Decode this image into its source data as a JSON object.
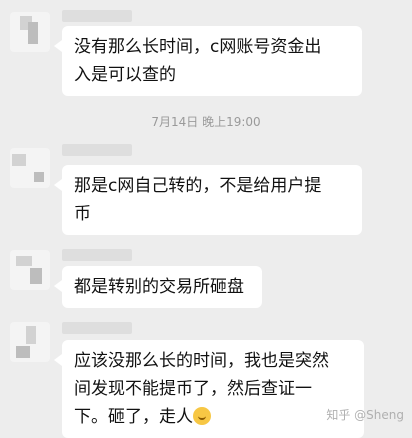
{
  "messages": [
    {
      "lines": [
        "没有那么长时间，c网账号资金出",
        "入是可以查的"
      ]
    },
    {
      "lines": [
        "那是c网自己转的，不是给用户提",
        "币"
      ]
    },
    {
      "lines": [
        "都是转别的交易所砸盘"
      ]
    },
    {
      "lines": [
        "应该没那么长的时间，我也是突然",
        "间发现不能提币了，然后查证一",
        "下。砸了，走人"
      ],
      "emoji": "smile-emoji"
    }
  ],
  "timestamp": "7月14日 晚上19:00",
  "watermark": "知乎 @Sheng"
}
